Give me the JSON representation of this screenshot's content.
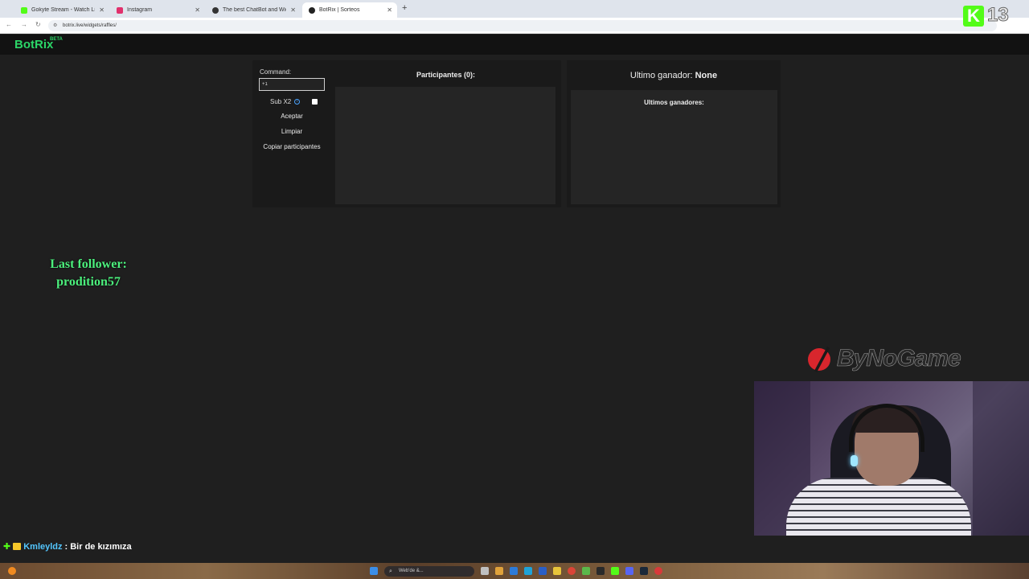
{
  "browser": {
    "tabs": [
      {
        "title": "Gokyte Stream - Watch Live on",
        "favicon_color": "#53fc18",
        "active": false
      },
      {
        "title": "Instagram",
        "favicon_color": "#e1306c",
        "active": false
      },
      {
        "title": "The best ChatBot and Widgets",
        "favicon_color": "#333333",
        "active": false
      },
      {
        "title": "BotRix | Sorteos",
        "favicon_color": "#222222",
        "active": true
      }
    ],
    "new_tab": "+",
    "url": "botrix.live/widgets/raffles/"
  },
  "site": {
    "logo": "BotRix",
    "beta": "BETA"
  },
  "raffle": {
    "command_label": "Command:",
    "command_value": "+1",
    "sub_label": "Sub X2",
    "sub_checked": false,
    "accept_label": "Aceptar",
    "clear_label": "Limpiar",
    "copy_label": "Copiar participantes",
    "participants_title": "Participantes (0):",
    "participants": []
  },
  "winners": {
    "last_winner_label": "Ultimo ganador:",
    "last_winner_value": "None",
    "list_title": "Ultimos ganadores:",
    "list": []
  },
  "overlay": {
    "last_follower_label": "Last follower:",
    "last_follower_name": "prodition57",
    "sponsor": "ByNoGame",
    "kick_letter": "K",
    "kick_number": "13",
    "chat": {
      "user": "Kmleyldz",
      "message": ": Bir de kızımıza"
    }
  },
  "taskbar": {
    "search_placeholder": "Web'de &..."
  },
  "colors": {
    "brand_green": "#2bd567",
    "follower_green": "#4cf07d",
    "kick_green": "#53fc18"
  }
}
